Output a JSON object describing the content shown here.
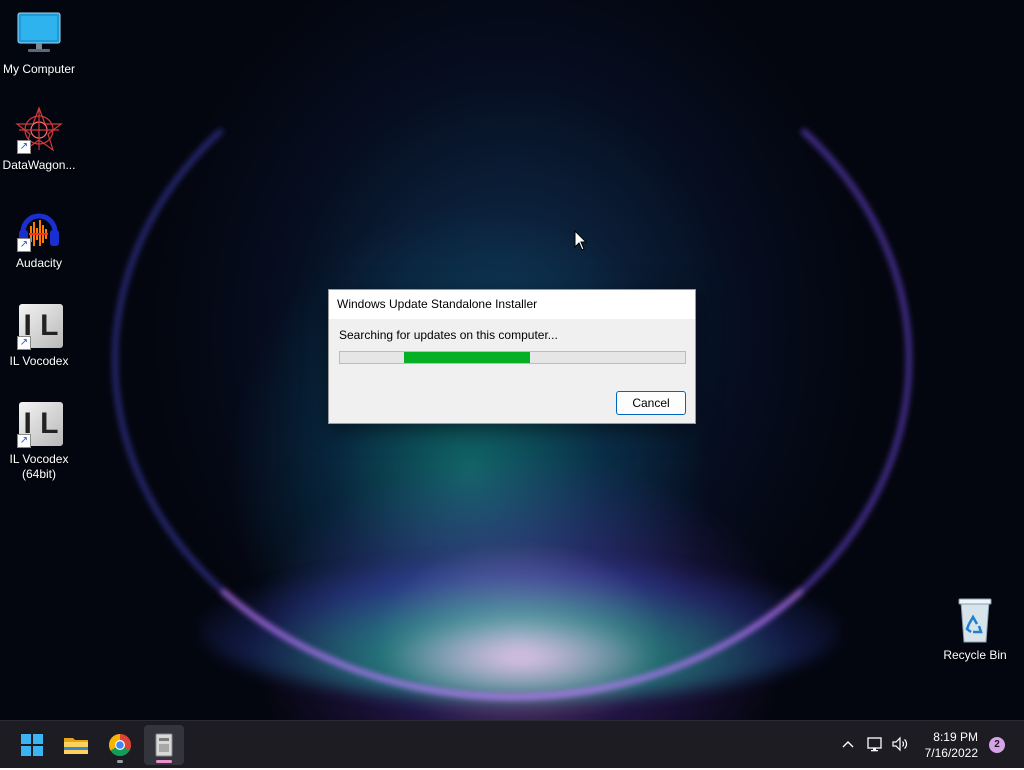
{
  "desktop": {
    "icons": [
      {
        "label": "My Computer"
      },
      {
        "label": "DataWagon..."
      },
      {
        "label": "Audacity"
      },
      {
        "label": "IL Vocodex"
      },
      {
        "label": "IL Vocodex (64bit)"
      },
      {
        "label": "Recycle Bin"
      }
    ],
    "il_logo_text": "I L"
  },
  "dialog": {
    "title": "Windows Update Standalone Installer",
    "message": "Searching for updates on this computer...",
    "progress_indeterminate": true,
    "progress_segment_start": 0.185,
    "progress_segment_fraction": 0.365,
    "cancel_label": "Cancel"
  },
  "taskbar": {
    "apps": [
      "start-icon",
      "file-explorer-icon",
      "chrome-icon",
      "installer-icon"
    ],
    "time": "8:19 PM",
    "date": "7/16/2022",
    "notification_count": "2"
  },
  "colors": {
    "progress_green": "#06b025",
    "button_border": "#0067c0"
  }
}
